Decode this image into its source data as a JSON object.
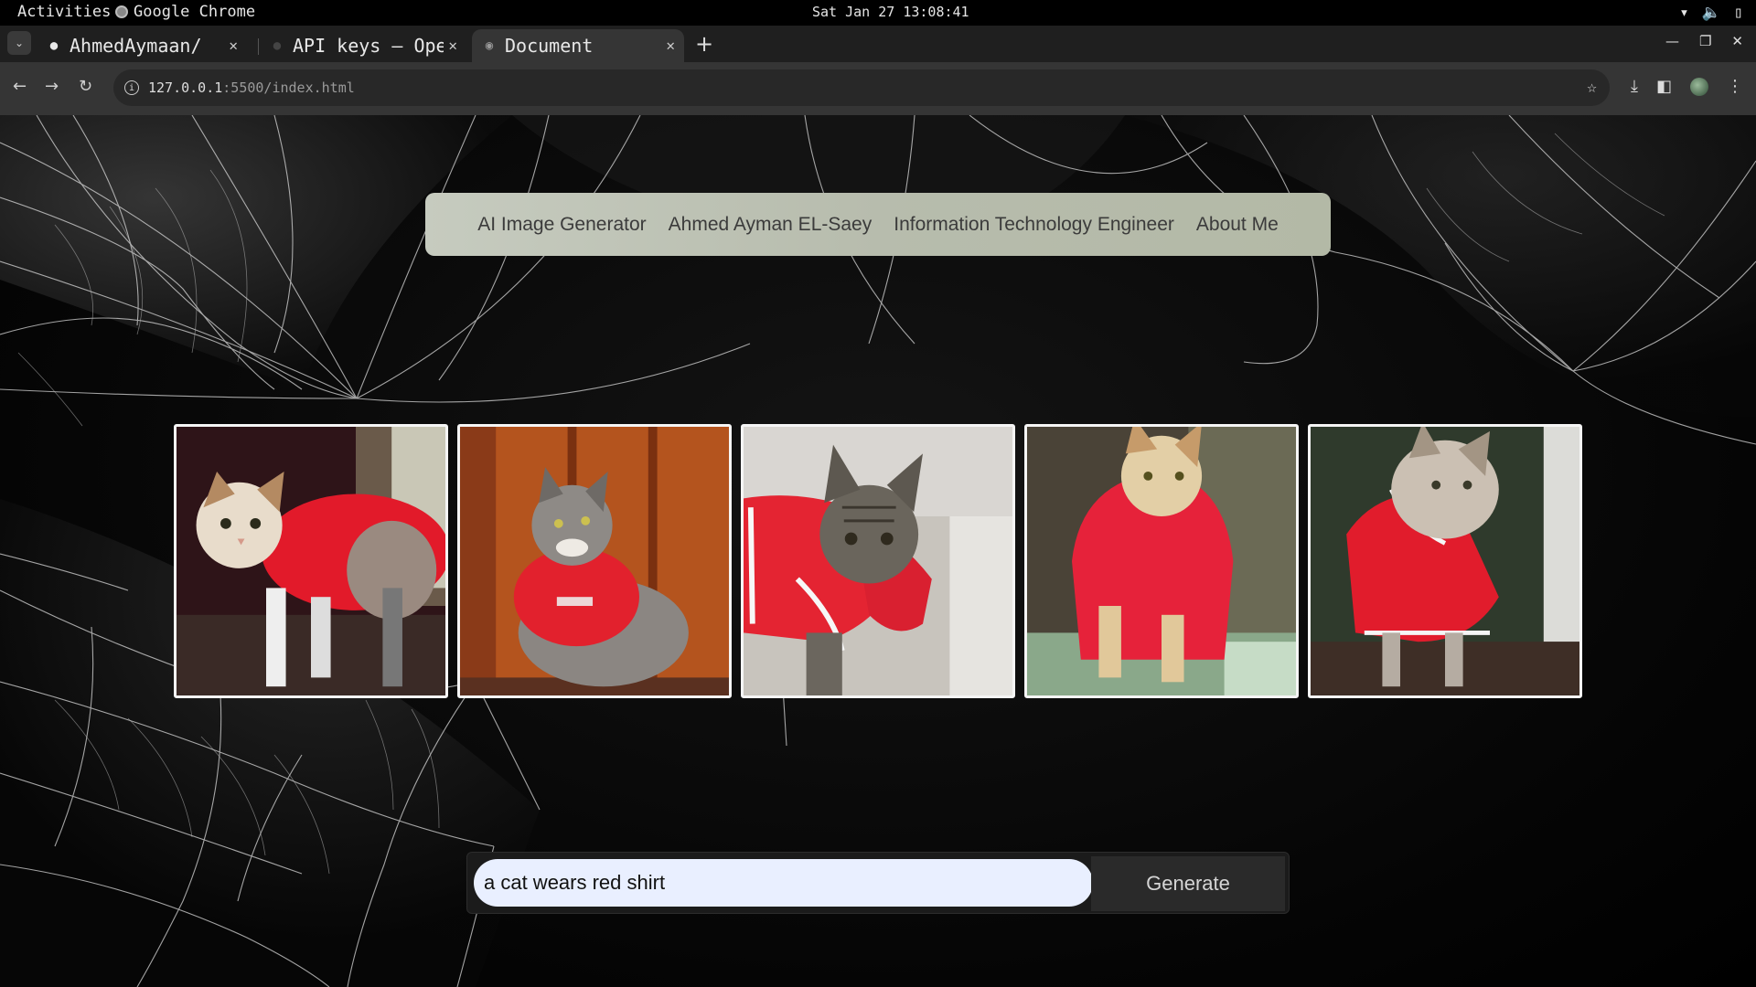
{
  "system_bar": {
    "activities": "Activities",
    "app_name": "Google Chrome",
    "clock": "Sat Jan 27 13:08:41"
  },
  "tabs": [
    {
      "title": "AhmedAymaan/",
      "icon": "github-icon",
      "active": false
    },
    {
      "title": "API keys – Ope",
      "icon": "openai-icon",
      "active": false
    },
    {
      "title": "Document",
      "icon": "globe-icon",
      "active": true
    }
  ],
  "address_bar": {
    "host": "127.0.0.1",
    "port_path": ":5500/index.html"
  },
  "navbar": {
    "items": [
      "AI Image Generator",
      "Ahmed Ayman EL-Saey",
      "Information Technology Engineer",
      "About Me"
    ]
  },
  "gallery": {
    "images": [
      "cat-image-1",
      "cat-image-2",
      "cat-image-3",
      "cat-image-4",
      "cat-image-5"
    ]
  },
  "prompt": {
    "value": "a cat wears red shirt",
    "button_label": "Generate"
  },
  "colors": {
    "navbar_bg": "#c3c8bb",
    "shirt_red": "#e0202e",
    "input_bg": "#e9efff"
  }
}
